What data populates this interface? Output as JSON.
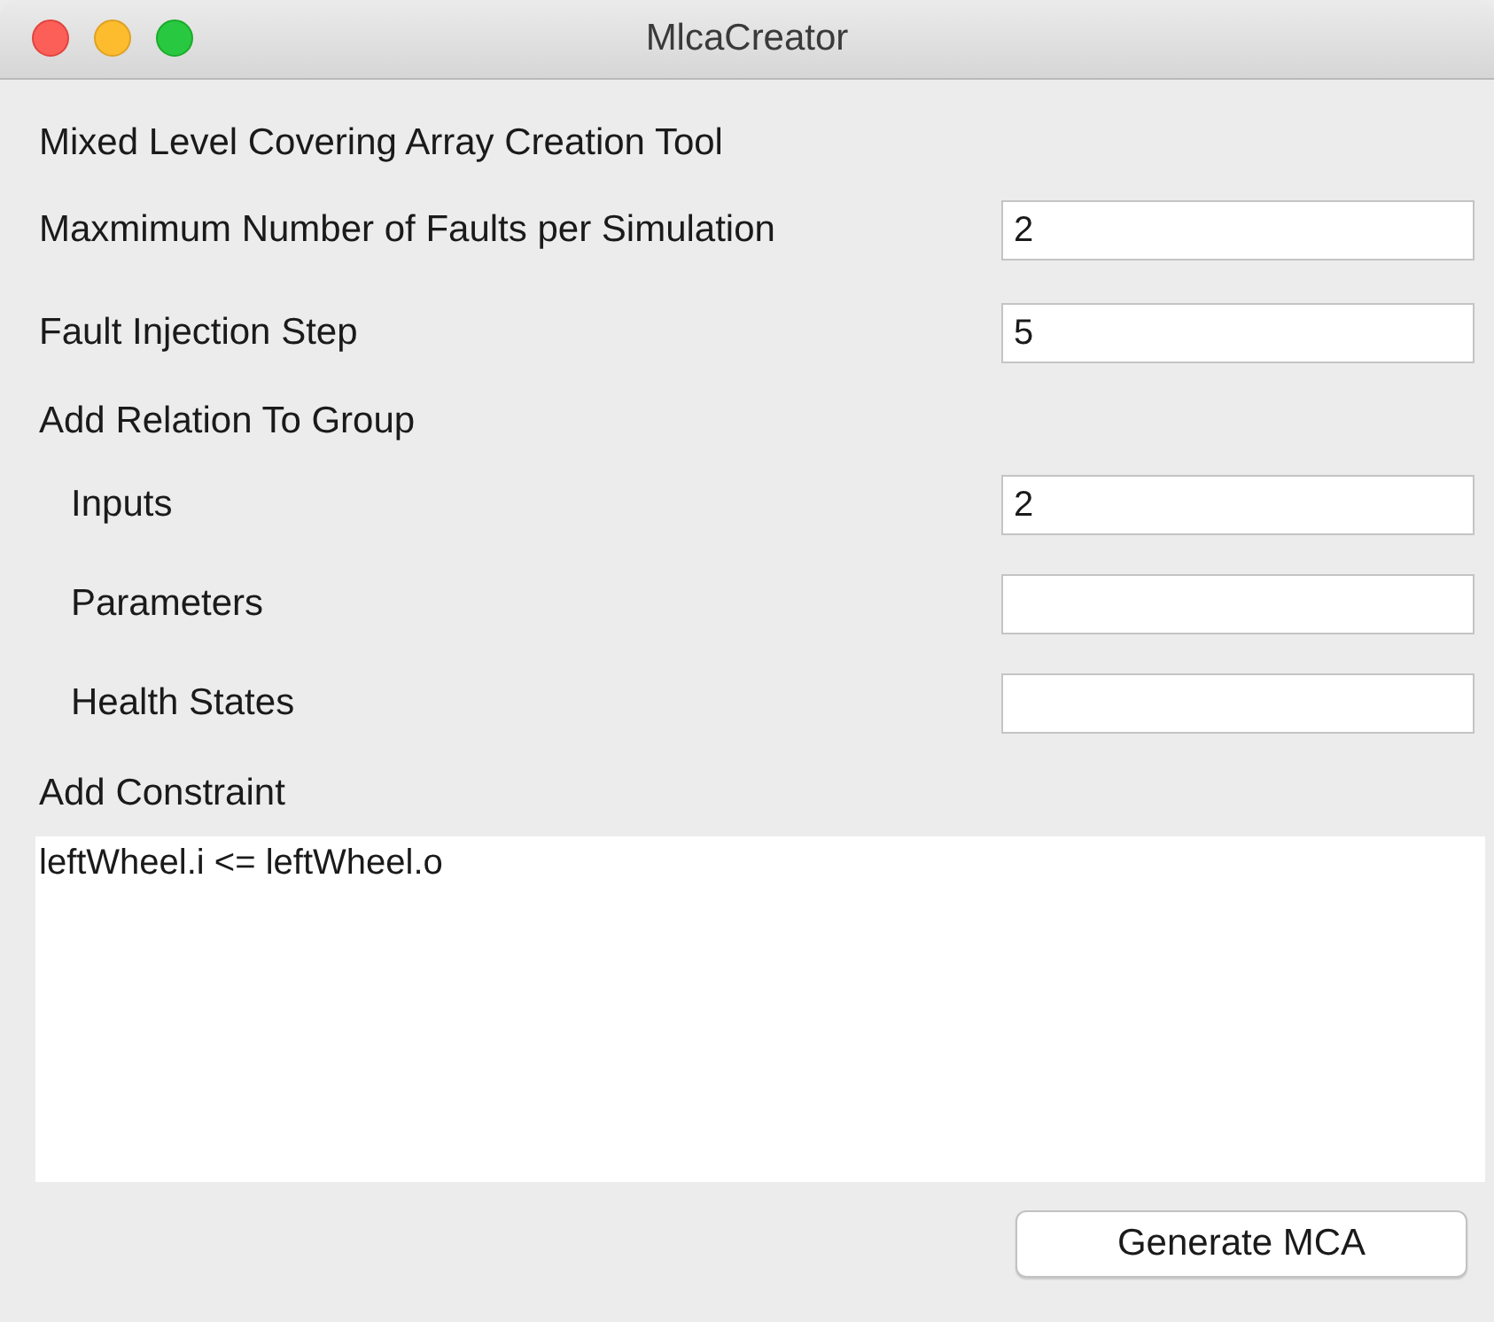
{
  "window": {
    "title": "MlcaCreator"
  },
  "heading": "Mixed Level Covering Array Creation Tool",
  "fields": [
    {
      "label": "Maxmimum Number of Faults per Simulation",
      "value": "2"
    },
    {
      "label": "Fault Injection Step",
      "value": "5"
    }
  ],
  "group": {
    "label": "Add Relation To Group",
    "fields": [
      {
        "label": "Inputs",
        "value": "2"
      },
      {
        "label": "Parameters"
      },
      {
        "label": "Health States"
      }
    ]
  },
  "constraint": {
    "label": "Add Constraint",
    "value": "leftWheel.i <= leftWheel.o"
  },
  "buttons": [
    "Generate MCA"
  ]
}
